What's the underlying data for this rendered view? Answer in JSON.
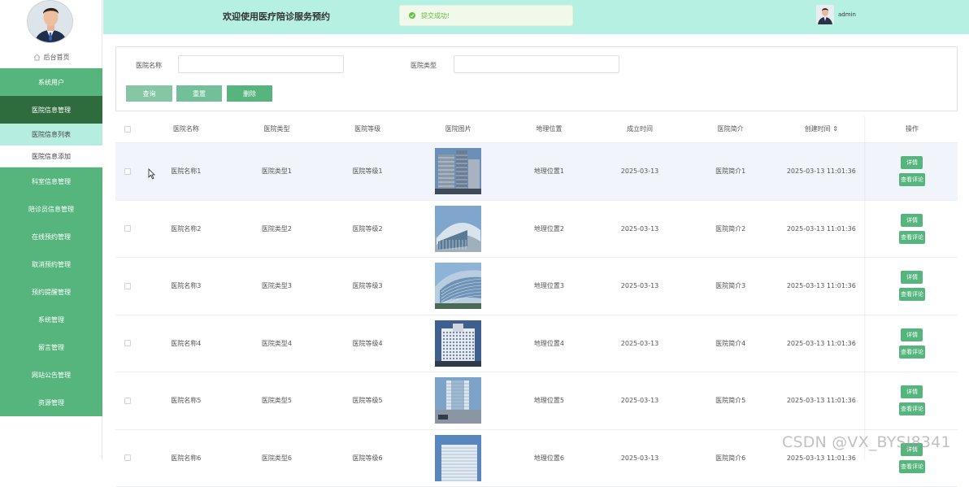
{
  "header": {
    "title": "欢迎使用医疗陪诊服务预约",
    "toast": "提交成功!",
    "username": "admin"
  },
  "sidebar": {
    "home_label": "后台首页",
    "items": [
      {
        "label": "系统用户"
      },
      {
        "label": "医院信息管理",
        "active": true
      },
      {
        "label": "医院信息列表",
        "sub": true,
        "selected": true
      },
      {
        "label": "医院信息添加",
        "sub": true
      },
      {
        "label": "科室信息管理"
      },
      {
        "label": "陪诊员信息管理"
      },
      {
        "label": "在线预约管理"
      },
      {
        "label": "取消预约管理"
      },
      {
        "label": "预约提醒管理"
      },
      {
        "label": "系统管理"
      },
      {
        "label": "留言管理"
      },
      {
        "label": "网站公告管理"
      },
      {
        "label": "资源管理"
      }
    ]
  },
  "search": {
    "name_label": "医院名称",
    "name_value": "",
    "type_label": "医院类型",
    "type_value": "",
    "query_button": "查询",
    "reset_button": "重置",
    "delete_button": "删除"
  },
  "table": {
    "headers": [
      "医院名称",
      "医院类型",
      "医院等级",
      "医院图片",
      "地理位置",
      "成立时间",
      "医院简介",
      "创建时间 ⇕",
      "操作"
    ],
    "detail_label": "详情",
    "review_label": "查看评论",
    "rows": [
      {
        "name": "医院名称1",
        "type": "医院类型1",
        "level": "医院等级1",
        "location": "地理位置1",
        "founded": "2025-03-13",
        "intro": "医院简介1",
        "created": "2025-03-13 11:01:36"
      },
      {
        "name": "医院名称2",
        "type": "医院类型2",
        "level": "医院等级2",
        "location": "地理位置2",
        "founded": "2025-03-13",
        "intro": "医院简介2",
        "created": "2025-03-13 11:01:36"
      },
      {
        "name": "医院名称3",
        "type": "医院类型3",
        "level": "医院等级3",
        "location": "地理位置3",
        "founded": "2025-03-13",
        "intro": "医院简介3",
        "created": "2025-03-13 11:01:36"
      },
      {
        "name": "医院名称4",
        "type": "医院类型4",
        "level": "医院等级4",
        "location": "地理位置4",
        "founded": "2025-03-13",
        "intro": "医院简介4",
        "created": "2025-03-13 11:01:36"
      },
      {
        "name": "医院名称5",
        "type": "医院类型5",
        "level": "医院等级5",
        "location": "地理位置5",
        "founded": "2025-03-13",
        "intro": "医院简介5",
        "created": "2025-03-13 11:01:36"
      },
      {
        "name": "医院名称6",
        "type": "医院类型6",
        "level": "医院等级6",
        "location": "地理位置6",
        "founded": "2025-03-13",
        "intro": "医院简介6",
        "created": "2025-03-13 11:01:36"
      }
    ]
  },
  "watermark": "CSDN @VX_BYSJ8341",
  "colors": {
    "header_bg": "#b6f0e3",
    "menu_bg": "#56b47d",
    "menu_active": "#2e6b3d",
    "submenu_selected": "#b5eee0",
    "query_btn": "#86c6a4",
    "reset_btn": "#72c09a",
    "delete_btn": "#56b47d"
  }
}
